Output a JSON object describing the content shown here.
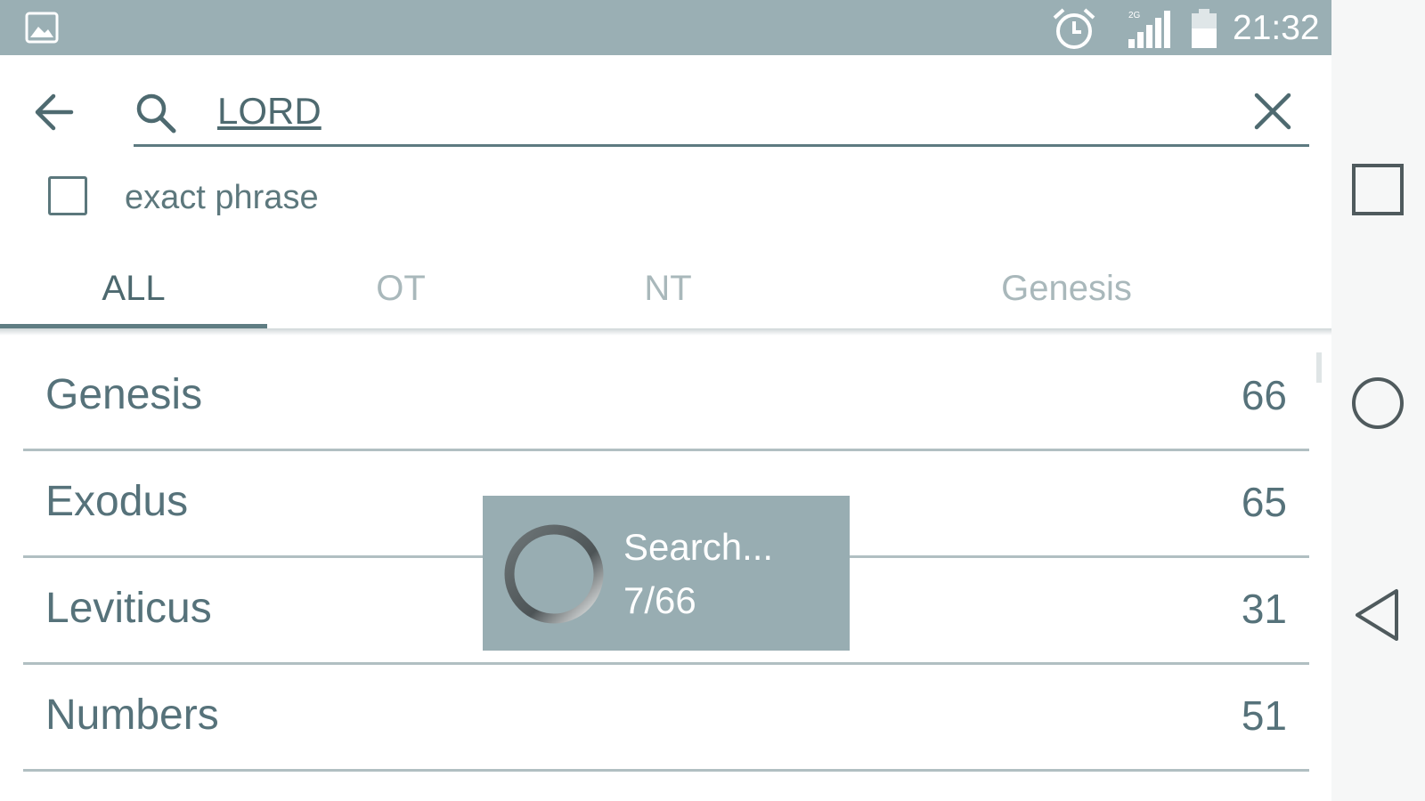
{
  "status_bar": {
    "time": "21:32",
    "icons": [
      "gallery-icon",
      "alarm-icon",
      "signal-2g-icon",
      "battery-icon"
    ],
    "background": "#9aafb4"
  },
  "search": {
    "value": "LORD",
    "back_icon": "arrow-left-icon",
    "search_icon": "search-icon",
    "clear_icon": "close-icon"
  },
  "exact_phrase": {
    "label": "exact phrase",
    "checked": false
  },
  "tabs": [
    {
      "label": "ALL",
      "active": true
    },
    {
      "label": "OT",
      "active": false
    },
    {
      "label": "NT",
      "active": false
    },
    {
      "label": "Genesis",
      "active": false
    }
  ],
  "results": [
    {
      "book": "Genesis",
      "count": "66"
    },
    {
      "book": "Exodus",
      "count": "65"
    },
    {
      "book": "Leviticus",
      "count": "31"
    },
    {
      "book": "Numbers",
      "count": "51"
    }
  ],
  "progress_dialog": {
    "title": "Search...",
    "progress": "7/66"
  },
  "nav_bar": {
    "icons": [
      "recents-square-icon",
      "home-circle-icon",
      "back-triangle-icon"
    ]
  },
  "colors": {
    "accent": "#5f7d83",
    "text": "#56727a",
    "inactive_tab": "#a9b8bb"
  }
}
